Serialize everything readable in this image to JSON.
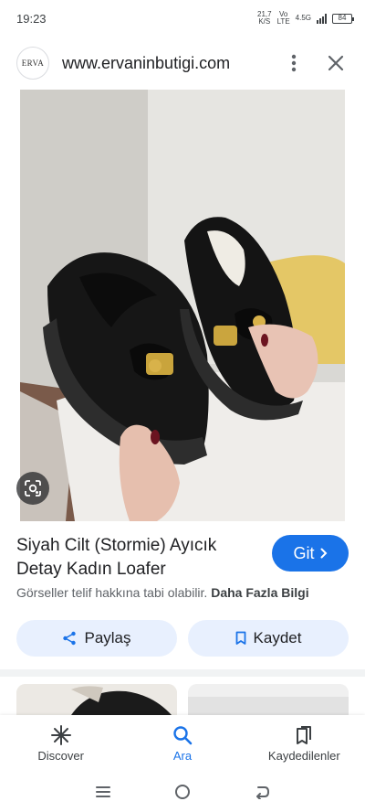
{
  "status_bar": {
    "time": "19:23",
    "data_speed_top": "21,7",
    "data_speed_bottom": "K/S",
    "volte_top": "Vo",
    "volte_bottom": "LTE",
    "network": "4.5G",
    "battery": "84"
  },
  "header": {
    "logo_text": "ERVA",
    "site_url": "www.ervaninbutigi.com"
  },
  "result": {
    "title": "Siyah Cilt (Stormie) Ayıcık Detay Kadın Loafer",
    "visit_label": "Git",
    "copyright_notice": "Görseller telif hakkına tabi olabilir.",
    "more_info_label": "Daha Fazla Bilgi",
    "share_label": "Paylaş",
    "save_label": "Kaydet"
  },
  "bottom_nav": {
    "discover_label": "Discover",
    "search_label": "Ara",
    "saved_label": "Kaydedilenler"
  },
  "colors": {
    "accent": "#1a73e8",
    "pill_background": "#e8f0fe"
  },
  "icons": [
    "more-vert-icon",
    "close-icon",
    "google-lens-icon",
    "chevron-right-icon",
    "share-icon",
    "bookmark-icon",
    "discover-asterisk-icon",
    "search-icon",
    "saved-collections-icon",
    "recent-apps-icon",
    "home-icon",
    "back-icon"
  ]
}
